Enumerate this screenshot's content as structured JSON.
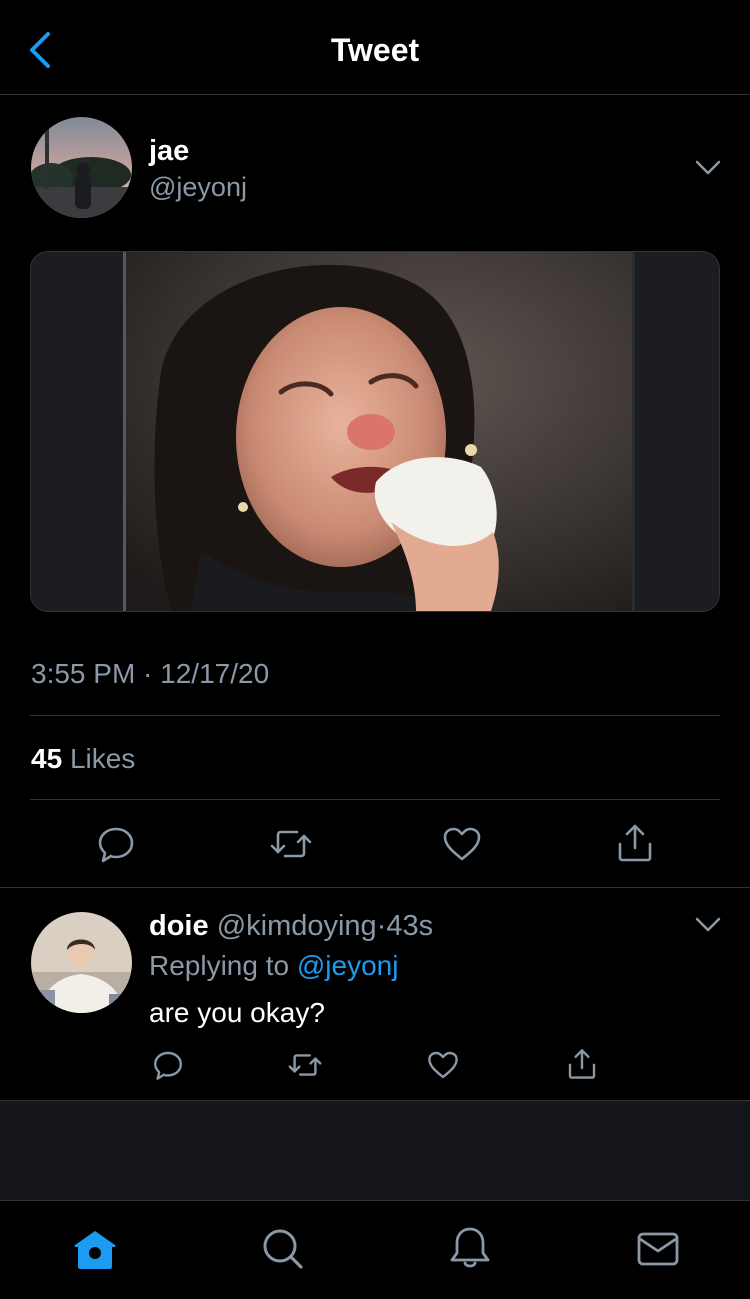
{
  "header": {
    "title": "Tweet"
  },
  "tweet": {
    "author_name": "jae",
    "author_handle": "@jeyonj",
    "timestamp": "3:55 PM · 12/17/20",
    "likes_count": "45",
    "likes_label": "Likes"
  },
  "reply": {
    "author_name": "doie",
    "author_handle": "@kimdoying",
    "age": "43s",
    "replying_label": "Replying to",
    "replying_handle": "@jeyonj",
    "text": "are you okay?"
  },
  "icons": {
    "back": "chevron-left-icon",
    "more": "chevron-down-icon",
    "reply": "comment-icon",
    "retweet": "retweet-icon",
    "like": "heart-icon",
    "share": "share-icon",
    "home": "home-icon",
    "search": "search-icon",
    "notifications": "bell-icon",
    "messages": "mail-icon"
  },
  "colors": {
    "background": "#000000",
    "accent": "#1d9bf0",
    "secondary_text": "#8b98a5",
    "divider": "#2f3336"
  }
}
